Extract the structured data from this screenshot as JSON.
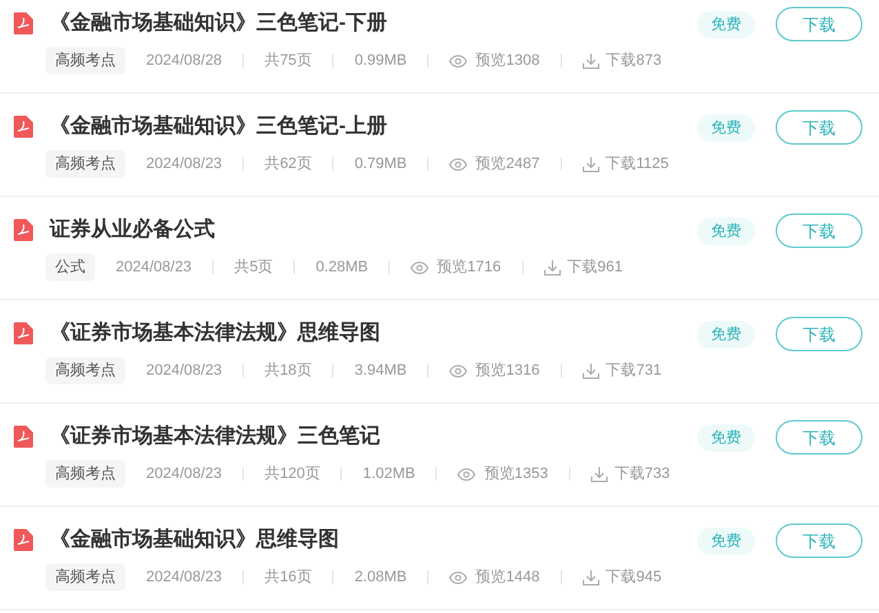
{
  "documents": [
    {
      "title": "《金融市场基础知识》三色笔记-下册",
      "tag": "高频考点",
      "date": "2024/08/28",
      "pages": "共75页",
      "size": "0.99MB",
      "views": "预览1308",
      "downloads": "下载873",
      "badge": "免费",
      "button": "下载"
    },
    {
      "title": "《金融市场基础知识》三色笔记-上册",
      "tag": "高频考点",
      "date": "2024/08/23",
      "pages": "共62页",
      "size": "0.79MB",
      "views": "预览2487",
      "downloads": "下载1125",
      "badge": "免费",
      "button": "下载"
    },
    {
      "title": "证券从业必备公式",
      "tag": "公式",
      "date": "2024/08/23",
      "pages": "共5页",
      "size": "0.28MB",
      "views": "预览1716",
      "downloads": "下载961",
      "badge": "免费",
      "button": "下载"
    },
    {
      "title": "《证券市场基本法律法规》思维导图",
      "tag": "高频考点",
      "date": "2024/08/23",
      "pages": "共18页",
      "size": "3.94MB",
      "views": "预览1316",
      "downloads": "下载731",
      "badge": "免费",
      "button": "下载"
    },
    {
      "title": "《证券市场基本法律法规》三色笔记",
      "tag": "高频考点",
      "date": "2024/08/23",
      "pages": "共120页",
      "size": "1.02MB",
      "views": "预览1353",
      "downloads": "下载733",
      "badge": "免费",
      "button": "下载"
    },
    {
      "title": "《金融市场基础知识》思维导图",
      "tag": "高频考点",
      "date": "2024/08/23",
      "pages": "共16页",
      "size": "2.08MB",
      "views": "预览1448",
      "downloads": "下载945",
      "badge": "免费",
      "button": "下载"
    }
  ]
}
